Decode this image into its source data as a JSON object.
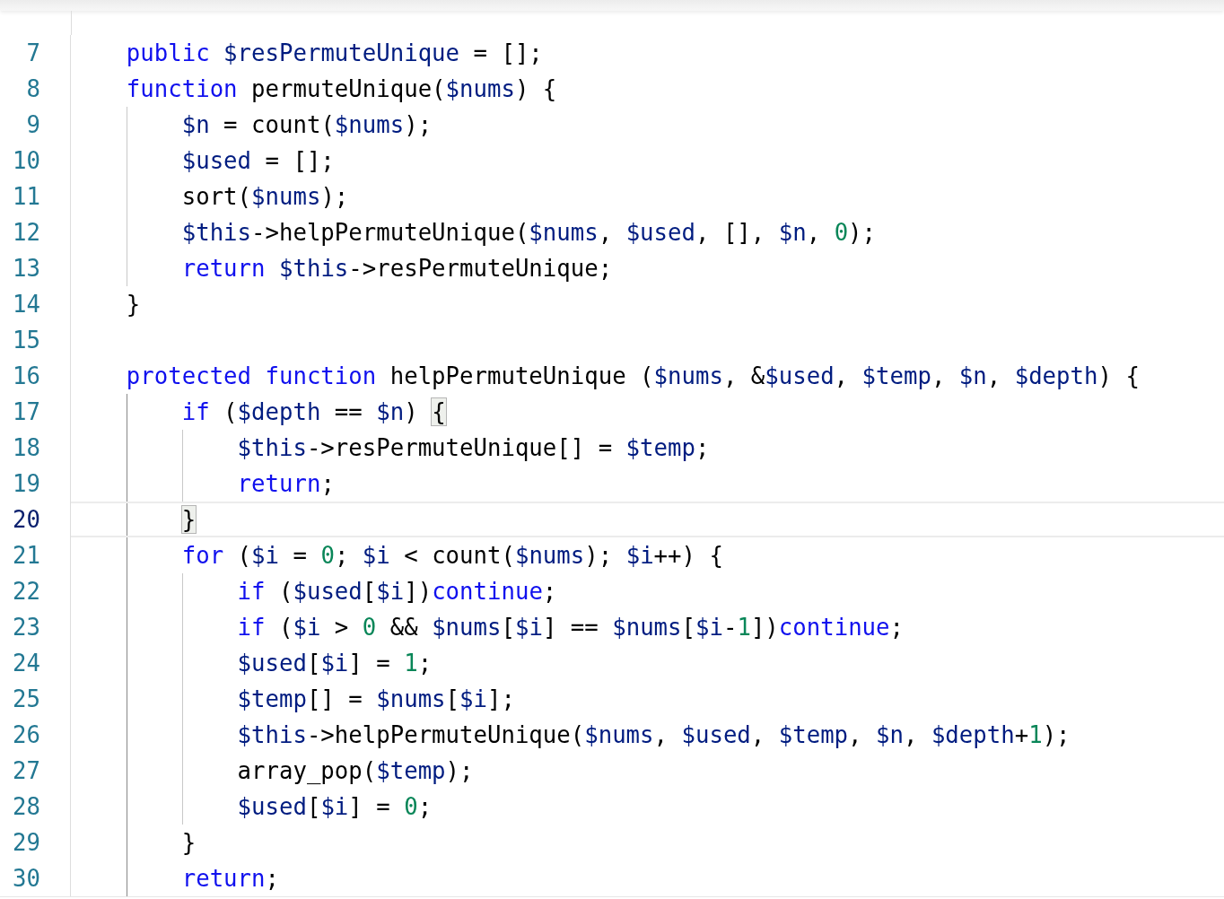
{
  "editor": {
    "lines": [
      {
        "number": "7",
        "current": false,
        "tokens": [
          {
            "kind": "keyword",
            "text": "    public"
          },
          {
            "kind": "variable",
            "text": " $resPermuteUnique"
          },
          {
            "kind": "plain",
            "text": " = [];"
          }
        ]
      },
      {
        "number": "8",
        "current": false,
        "tokens": [
          {
            "kind": "keyword",
            "text": "    function"
          },
          {
            "kind": "plain",
            "text": " permuteUnique("
          },
          {
            "kind": "variable",
            "text": "$nums"
          },
          {
            "kind": "plain",
            "text": ") {"
          }
        ]
      },
      {
        "number": "9",
        "current": false,
        "tokens": [
          {
            "kind": "variable",
            "text": "        $n"
          },
          {
            "kind": "plain",
            "text": " = count("
          },
          {
            "kind": "variable",
            "text": "$nums"
          },
          {
            "kind": "plain",
            "text": ");"
          }
        ]
      },
      {
        "number": "10",
        "current": false,
        "tokens": [
          {
            "kind": "variable",
            "text": "        $used"
          },
          {
            "kind": "plain",
            "text": " = [];"
          }
        ]
      },
      {
        "number": "11",
        "current": false,
        "tokens": [
          {
            "kind": "plain",
            "text": "        sort("
          },
          {
            "kind": "variable",
            "text": "$nums"
          },
          {
            "kind": "plain",
            "text": ");"
          }
        ]
      },
      {
        "number": "12",
        "current": false,
        "tokens": [
          {
            "kind": "variable",
            "text": "        $this"
          },
          {
            "kind": "plain",
            "text": "->helpPermuteUnique("
          },
          {
            "kind": "variable",
            "text": "$nums"
          },
          {
            "kind": "plain",
            "text": ", "
          },
          {
            "kind": "variable",
            "text": "$used"
          },
          {
            "kind": "plain",
            "text": ", [], "
          },
          {
            "kind": "variable",
            "text": "$n"
          },
          {
            "kind": "plain",
            "text": ", "
          },
          {
            "kind": "number",
            "text": "0"
          },
          {
            "kind": "plain",
            "text": ");"
          }
        ]
      },
      {
        "number": "13",
        "current": false,
        "tokens": [
          {
            "kind": "keyword",
            "text": "        return"
          },
          {
            "kind": "variable",
            "text": " $this"
          },
          {
            "kind": "plain",
            "text": "->resPermuteUnique;"
          }
        ]
      },
      {
        "number": "14",
        "current": false,
        "tokens": [
          {
            "kind": "plain",
            "text": "    }"
          }
        ]
      },
      {
        "number": "15",
        "current": false
      },
      {
        "number": "16",
        "current": false,
        "tokens": [
          {
            "kind": "keyword",
            "text": "    protected"
          },
          {
            "kind": "keyword",
            "text": " function"
          },
          {
            "kind": "plain",
            "text": " helpPermuteUnique ("
          },
          {
            "kind": "variable",
            "text": "$nums"
          },
          {
            "kind": "plain",
            "text": ", &"
          },
          {
            "kind": "variable",
            "text": "$used"
          },
          {
            "kind": "plain",
            "text": ", "
          },
          {
            "kind": "variable",
            "text": "$temp"
          },
          {
            "kind": "plain",
            "text": ", "
          },
          {
            "kind": "variable",
            "text": "$n"
          },
          {
            "kind": "plain",
            "text": ", "
          },
          {
            "kind": "variable",
            "text": "$depth"
          },
          {
            "kind": "plain",
            "text": ") {"
          }
        ]
      },
      {
        "number": "17",
        "current": false,
        "tokens": [
          {
            "kind": "keyword",
            "text": "        if"
          },
          {
            "kind": "plain",
            "text": " ("
          },
          {
            "kind": "variable",
            "text": "$depth"
          },
          {
            "kind": "plain",
            "text": " == "
          },
          {
            "kind": "variable",
            "text": "$n"
          },
          {
            "kind": "plain",
            "text": ") "
          },
          {
            "kind": "bracket-match",
            "text": "{"
          }
        ]
      },
      {
        "number": "18",
        "current": false,
        "tokens": [
          {
            "kind": "variable",
            "text": "            $this"
          },
          {
            "kind": "plain",
            "text": "->resPermuteUnique[] = "
          },
          {
            "kind": "variable",
            "text": "$temp"
          },
          {
            "kind": "plain",
            "text": ";"
          }
        ]
      },
      {
        "number": "19",
        "current": false,
        "tokens": [
          {
            "kind": "keyword",
            "text": "            return"
          },
          {
            "kind": "plain",
            "text": ";"
          }
        ]
      },
      {
        "number": "20",
        "current": true,
        "tokens": [
          {
            "kind": "bracket-match",
            "text": "        }"
          }
        ]
      },
      {
        "number": "21",
        "current": false,
        "tokens": [
          {
            "kind": "keyword",
            "text": "        for"
          },
          {
            "kind": "plain",
            "text": " ("
          },
          {
            "kind": "variable",
            "text": "$i"
          },
          {
            "kind": "plain",
            "text": " = "
          },
          {
            "kind": "number",
            "text": "0"
          },
          {
            "kind": "plain",
            "text": "; "
          },
          {
            "kind": "variable",
            "text": "$i"
          },
          {
            "kind": "plain",
            "text": " < count("
          },
          {
            "kind": "variable",
            "text": "$nums"
          },
          {
            "kind": "plain",
            "text": "); "
          },
          {
            "kind": "variable",
            "text": "$i"
          },
          {
            "kind": "plain",
            "text": "++) {"
          }
        ]
      },
      {
        "number": "22",
        "current": false,
        "tokens": [
          {
            "kind": "keyword",
            "text": "            if"
          },
          {
            "kind": "plain",
            "text": " ("
          },
          {
            "kind": "variable",
            "text": "$used"
          },
          {
            "kind": "plain",
            "text": "["
          },
          {
            "kind": "variable",
            "text": "$i"
          },
          {
            "kind": "plain",
            "text": "])"
          },
          {
            "kind": "keyword",
            "text": "continue"
          },
          {
            "kind": "plain",
            "text": ";"
          }
        ]
      },
      {
        "number": "23",
        "current": false,
        "tokens": [
          {
            "kind": "keyword",
            "text": "            if"
          },
          {
            "kind": "plain",
            "text": " ("
          },
          {
            "kind": "variable",
            "text": "$i"
          },
          {
            "kind": "plain",
            "text": " > "
          },
          {
            "kind": "number",
            "text": "0"
          },
          {
            "kind": "plain",
            "text": " && "
          },
          {
            "kind": "variable",
            "text": "$nums"
          },
          {
            "kind": "plain",
            "text": "["
          },
          {
            "kind": "variable",
            "text": "$i"
          },
          {
            "kind": "plain",
            "text": "] == "
          },
          {
            "kind": "variable",
            "text": "$nums"
          },
          {
            "kind": "plain",
            "text": "["
          },
          {
            "kind": "variable",
            "text": "$i"
          },
          {
            "kind": "plain",
            "text": "-"
          },
          {
            "kind": "number",
            "text": "1"
          },
          {
            "kind": "plain",
            "text": "])"
          },
          {
            "kind": "keyword",
            "text": "continue"
          },
          {
            "kind": "plain",
            "text": ";"
          }
        ]
      },
      {
        "number": "24",
        "current": false,
        "tokens": [
          {
            "kind": "variable",
            "text": "            $used"
          },
          {
            "kind": "plain",
            "text": "["
          },
          {
            "kind": "variable",
            "text": "$i"
          },
          {
            "kind": "plain",
            "text": "] = "
          },
          {
            "kind": "number",
            "text": "1"
          },
          {
            "kind": "plain",
            "text": ";"
          }
        ]
      },
      {
        "number": "25",
        "current": false,
        "tokens": [
          {
            "kind": "variable",
            "text": "            $temp"
          },
          {
            "kind": "plain",
            "text": "[] = "
          },
          {
            "kind": "variable",
            "text": "$nums"
          },
          {
            "kind": "plain",
            "text": "["
          },
          {
            "kind": "variable",
            "text": "$i"
          },
          {
            "kind": "plain",
            "text": "];"
          }
        ]
      },
      {
        "number": "26",
        "current": false,
        "tokens": [
          {
            "kind": "variable",
            "text": "            $this"
          },
          {
            "kind": "plain",
            "text": "->helpPermuteUnique("
          },
          {
            "kind": "variable",
            "text": "$nums"
          },
          {
            "kind": "plain",
            "text": ", "
          },
          {
            "kind": "variable",
            "text": "$used"
          },
          {
            "kind": "plain",
            "text": ", "
          },
          {
            "kind": "variable",
            "text": "$temp"
          },
          {
            "kind": "plain",
            "text": ", "
          },
          {
            "kind": "variable",
            "text": "$n"
          },
          {
            "kind": "plain",
            "text": ", "
          },
          {
            "kind": "variable",
            "text": "$depth"
          },
          {
            "kind": "plain",
            "text": "+"
          },
          {
            "kind": "number",
            "text": "1"
          },
          {
            "kind": "plain",
            "text": ");"
          }
        ]
      },
      {
        "number": "27",
        "current": false,
        "tokens": [
          {
            "kind": "plain",
            "text": "            array_pop("
          },
          {
            "kind": "variable",
            "text": "$temp"
          },
          {
            "kind": "plain",
            "text": ");"
          }
        ]
      },
      {
        "number": "28",
        "current": false,
        "tokens": [
          {
            "kind": "variable",
            "text": "            $used"
          },
          {
            "kind": "plain",
            "text": "["
          },
          {
            "kind": "variable",
            "text": "$i"
          },
          {
            "kind": "plain",
            "text": "] = "
          },
          {
            "kind": "number",
            "text": "0"
          },
          {
            "kind": "plain",
            "text": ";"
          }
        ]
      },
      {
        "number": "29",
        "current": false,
        "tokens": [
          {
            "kind": "plain",
            "text": "        }"
          }
        ]
      },
      {
        "number": "30",
        "current": false,
        "tokens": [
          {
            "kind": "keyword",
            "text": "        return"
          },
          {
            "kind": "plain",
            "text": ";"
          }
        ]
      }
    ]
  }
}
